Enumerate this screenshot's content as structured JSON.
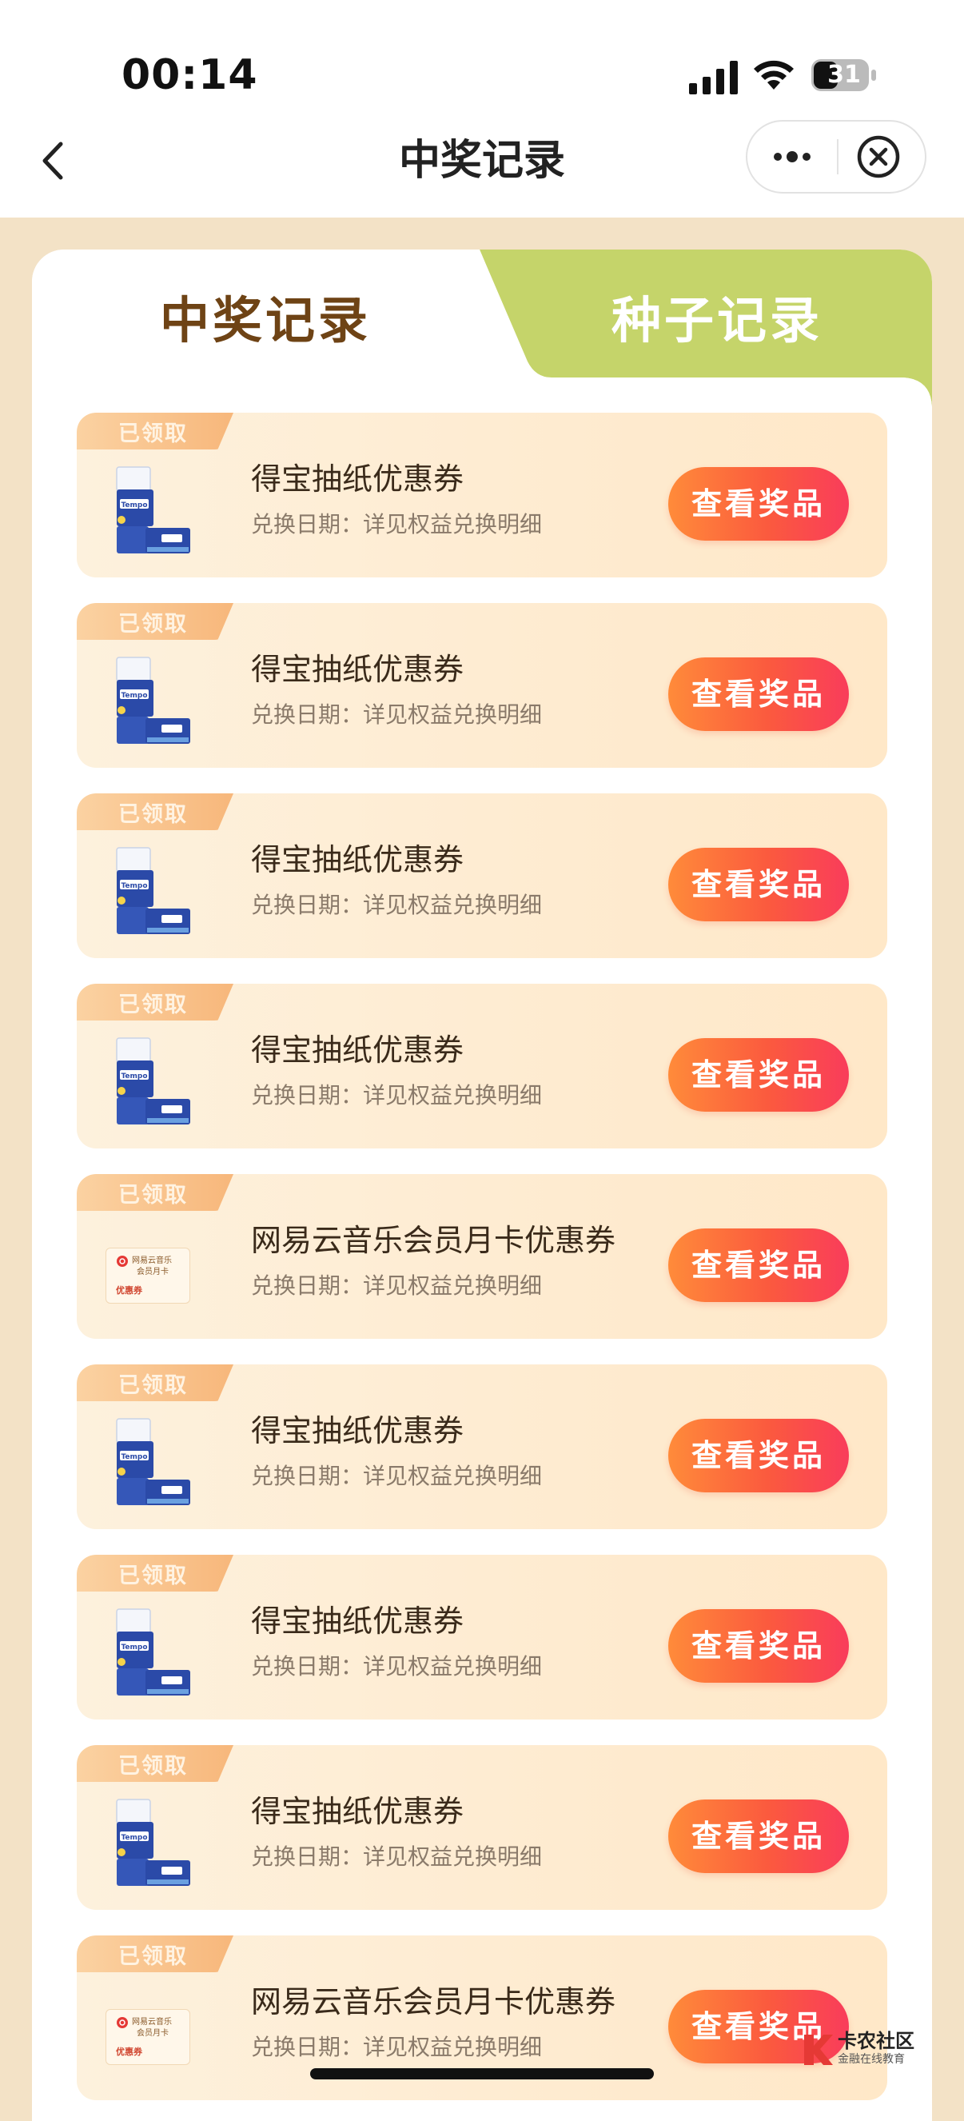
{
  "status_bar": {
    "time": "00:14",
    "battery": "31"
  },
  "nav": {
    "title": "中奖记录"
  },
  "tabs": [
    {
      "label": "中奖记录",
      "active": true
    },
    {
      "label": "种子记录",
      "active": false
    }
  ],
  "records": [
    {
      "badge": "已领取",
      "title": "得宝抽纸优惠券",
      "subtitle": "兑换日期：详见权益兑换明细",
      "button": "查看奖品",
      "thumb": "tissue-box"
    },
    {
      "badge": "已领取",
      "title": "得宝抽纸优惠券",
      "subtitle": "兑换日期：详见权益兑换明细",
      "button": "查看奖品",
      "thumb": "tissue-box"
    },
    {
      "badge": "已领取",
      "title": "得宝抽纸优惠券",
      "subtitle": "兑换日期：详见权益兑换明细",
      "button": "查看奖品",
      "thumb": "tissue-box"
    },
    {
      "badge": "已领取",
      "title": "得宝抽纸优惠券",
      "subtitle": "兑换日期：详见权益兑换明细",
      "button": "查看奖品",
      "thumb": "tissue-box"
    },
    {
      "badge": "已领取",
      "title": "网易云音乐会员月卡优惠券",
      "subtitle": "兑换日期：详见权益兑换明细",
      "button": "查看奖品",
      "thumb": "music-coupon"
    },
    {
      "badge": "已领取",
      "title": "得宝抽纸优惠券",
      "subtitle": "兑换日期：详见权益兑换明细",
      "button": "查看奖品",
      "thumb": "tissue-box"
    },
    {
      "badge": "已领取",
      "title": "得宝抽纸优惠券",
      "subtitle": "兑换日期：详见权益兑换明细",
      "button": "查看奖品",
      "thumb": "tissue-box"
    },
    {
      "badge": "已领取",
      "title": "得宝抽纸优惠券",
      "subtitle": "兑换日期：详见权益兑换明细",
      "button": "查看奖品",
      "thumb": "tissue-box"
    },
    {
      "badge": "已领取",
      "title": "网易云音乐会员月卡优惠券",
      "subtitle": "兑换日期：详见权益兑换明细",
      "button": "查看奖品",
      "thumb": "music-coupon"
    }
  ],
  "coupon_thumb": {
    "line1": "网易云音乐",
    "line2": "会员月卡",
    "tag": "优惠券"
  },
  "tissue_brand": "Tempo",
  "watermark": {
    "title": "卡农社区",
    "subtitle": "金融在线教育"
  },
  "colors": {
    "page_bg": "#f3e2c6",
    "tab_inactive_bg": "#c5d46a",
    "tab_active_text": "#6e4315",
    "button_gradient_start": "#ff8b3a",
    "button_gradient_end": "#f93c5b",
    "badge_bg": "#f7b77b"
  }
}
